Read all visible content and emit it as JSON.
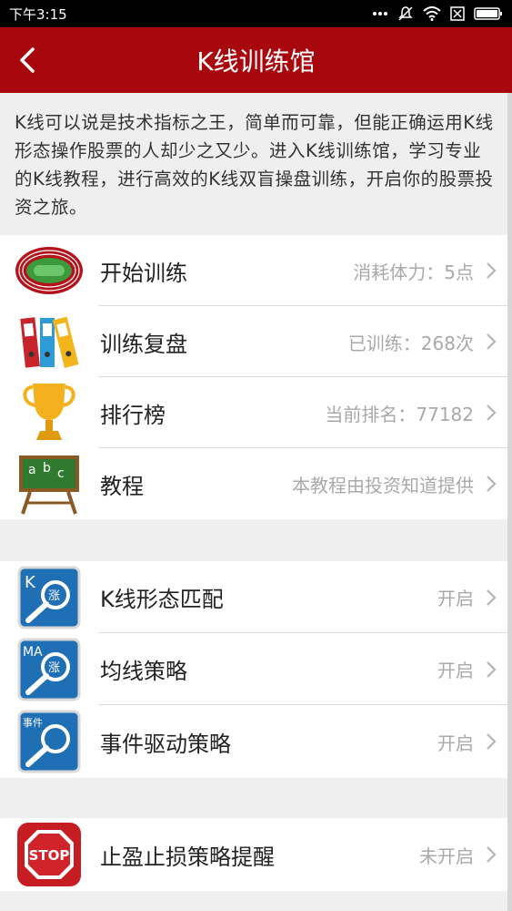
{
  "status_bar": {
    "time": "下午3:15"
  },
  "header": {
    "title": "K线训练馆"
  },
  "intro": {
    "text": "K线可以说是技术指标之王，简单而可靠，但能正确运用K线形态操作股票的人却少之又少。进入K线训练馆，学习专业的K线教程，进行高效的K线双盲操盘训练，开启你的股票投资之旅。"
  },
  "training": {
    "items": [
      {
        "label": "开始训练",
        "value": "消耗体力：5点",
        "icon": "track-field-icon"
      },
      {
        "label": "训练复盘",
        "value": "已训练：268次",
        "icon": "binders-icon"
      },
      {
        "label": "排行榜",
        "value": "当前排名：77182",
        "icon": "trophy-icon"
      },
      {
        "label": "教程",
        "value": "本教程由投资知道提供",
        "icon": "chalkboard-icon"
      }
    ]
  },
  "strategies": {
    "items": [
      {
        "label": "K线形态匹配",
        "value": "开启",
        "icon": "k-search-icon",
        "badge": "K",
        "badge2": "涨"
      },
      {
        "label": "均线策略",
        "value": "开启",
        "icon": "ma-search-icon",
        "badge": "MA",
        "badge2": "涨"
      },
      {
        "label": "事件驱动策略",
        "value": "开启",
        "icon": "event-search-icon",
        "badge": "事件"
      }
    ]
  },
  "alerts": {
    "items": [
      {
        "label": "止盈止损策略提醒",
        "value": "未开启",
        "icon": "stop-sign-icon",
        "badge": "STOP"
      }
    ]
  },
  "colors": {
    "brand_red": "#a8070d",
    "icon_blue": "#1f6fb5"
  }
}
